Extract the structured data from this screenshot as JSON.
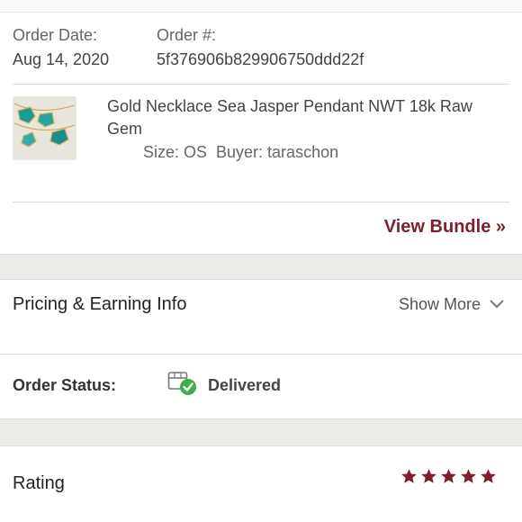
{
  "order": {
    "date_label": "Order Date:",
    "date_value": "Aug 14, 2020",
    "number_label": "Order #:",
    "number_value": "5f376906b829906750ddd22f"
  },
  "item": {
    "title": "Gold Necklace Sea Jasper Pendant NWT 18k Raw Gem",
    "details": "Size: OS  Buyer: taraschon",
    "thumbnail_icon": "product-photo-necklaces"
  },
  "bundle": {
    "view_label": "View Bundle »"
  },
  "pricing": {
    "title": "Pricing & Earning Info",
    "show_more_label": "Show More",
    "chevron_icon": "chevron-down-icon"
  },
  "status": {
    "label": "Order Status:",
    "value": "Delivered",
    "icon": "delivered-package-check-icon",
    "check_color": "#3fae4e"
  },
  "rating": {
    "label": "Rating",
    "stars_filled": 5,
    "stars_total": 5,
    "star_color": "#7f1f2e"
  },
  "colors": {
    "accent": "#7f1f2e",
    "band": "#eeece8",
    "divider": "#dcdcdc"
  }
}
